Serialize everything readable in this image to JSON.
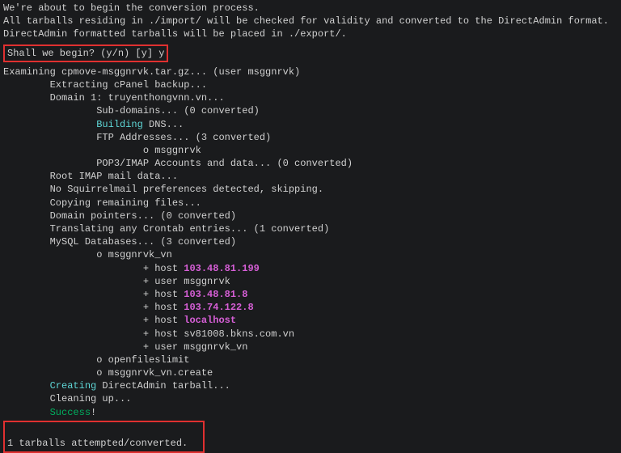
{
  "intro": {
    "l1": "We're about to begin the conversion process.",
    "l2": "All tarballs residing in ./import/ will be checked for validity and converted to the DirectAdmin format.",
    "l3": "DirectAdmin formatted tarballs will be placed in ./export/."
  },
  "prompt": {
    "text": "Shall we begin? (y/n) [y] y"
  },
  "log": {
    "examining": "Examining cpmove-msggnrvk.tar.gz... (user msggnrvk)",
    "extracting": "        Extracting cPanel backup...",
    "domain1": "        Domain 1: truyenthongvnn.vn...",
    "subdomains": "                Sub-domains... (0 converted)",
    "building_pad": "                ",
    "building_kw": "Building",
    "building_rest": " DNS...",
    "ftp": "                FTP Addresses... (3 converted)",
    "ftp_user": "                        o msggnrvk",
    "pop3": "                POP3/IMAP Accounts and data... (0 converted)",
    "root_imap": "        Root IMAP mail data...",
    "squirrel": "        No Squirrelmail preferences detected, skipping.",
    "copying": "        Copying remaining files...",
    "pointers": "        Domain pointers... (0 converted)",
    "crontab": "        Translating any Crontab entries... (1 converted)",
    "mysql": "        MySQL Databases... (3 converted)",
    "db1": "                o msggnrvk_vn",
    "h1_pad": "                        + host ",
    "h1_val": "103.48.81.199",
    "u1": "                        + user msggnrvk",
    "h2_pad": "                        + host ",
    "h2_val": "103.48.81.8",
    "h3_pad": "                        + host ",
    "h3_val": "103.74.122.8",
    "h4_pad": "                        + host ",
    "h4_val": "localhost",
    "h5": "                        + host sv81008.bkns.com.vn",
    "u2": "                        + user msggnrvk_vn",
    "db2": "                o openfileslimit",
    "db3": "                o msggnrvk_vn.create",
    "creating_pad": "        ",
    "creating_kw": "Creating",
    "creating_rest": " DirectAdmin tarball...",
    "cleaning": "        Cleaning up...",
    "success_pad": "        ",
    "success_kw": "Success",
    "success_rest": "!"
  },
  "summary": {
    "blank": " ",
    "text": "1 tarballs attempted/converted."
  }
}
